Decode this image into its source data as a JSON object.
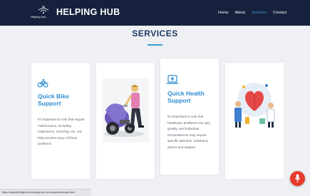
{
  "header": {
    "brand_title": "HELPING HUB",
    "brand_tagline": "Helping hub",
    "nav": [
      {
        "label": "Home"
      },
      {
        "label": "About"
      },
      {
        "label": "Services"
      },
      {
        "label": "Contact"
      }
    ],
    "active_nav": "Services"
  },
  "section": {
    "title": "SERVICES"
  },
  "cards": [
    {
      "icon": "bicycle-icon",
      "title": "Quick Bike Support",
      "text": "It's important to note that regular maintenance, including inspections, servicing, etc. can help prevent many of these problems."
    },
    {
      "image": "person-repairing-motorbike-illustration"
    },
    {
      "icon": "medical-laptop-icon",
      "title": "Quick Health Support",
      "text": "It's important to note that healthcare problems can vary greatly, and individual circumstances may require specific attention, treatment, advice and support."
    },
    {
      "image": "doctors-with-heart-illustration"
    }
  ],
  "status_url": "https://ancichhill.github.io/helping-hub-own-view/healthcare.html",
  "colors": {
    "header_bg": "#16213d",
    "accent": "#3f9ad7",
    "title": "#1c3a63",
    "fab": "#e53a2b"
  },
  "fab_icon": "mic-icon"
}
